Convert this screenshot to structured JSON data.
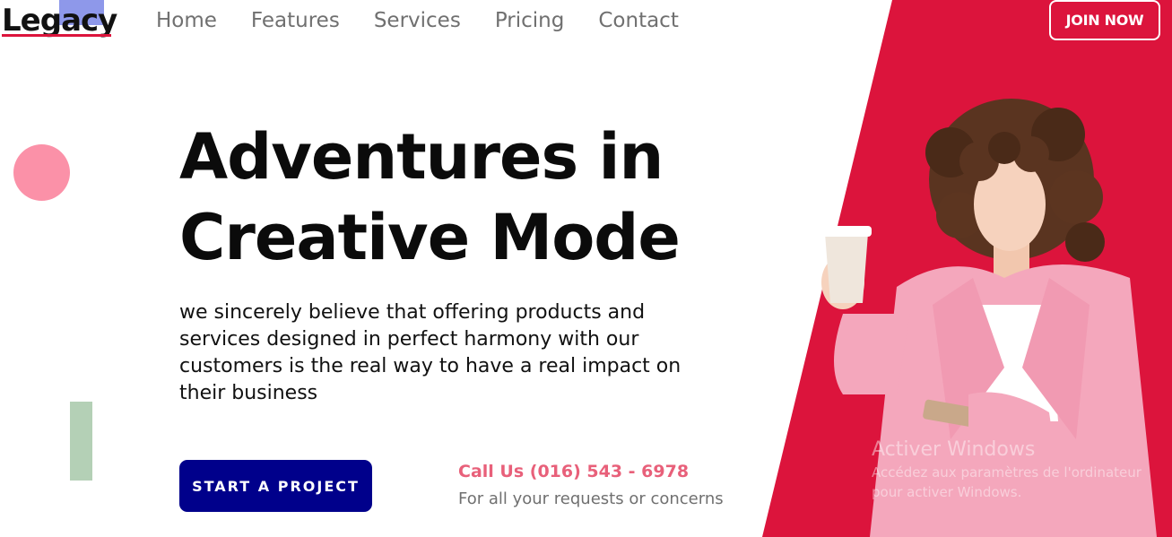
{
  "brand": {
    "logo": "Legacy"
  },
  "nav": {
    "items": [
      "Home",
      "Features",
      "Services",
      "Pricing",
      "Contact"
    ]
  },
  "header": {
    "join_label": "JOIN NOW"
  },
  "hero": {
    "headline_line1": "Adventures in",
    "headline_line2": "Creative Mode",
    "description": "we sincerely believe that offering products and services designed in perfect harmony with our customers is the real way to have a real impact on their business",
    "cta_label": "START A PROJECT",
    "call_text": "Call Us (016) 543 - 6978",
    "call_sub": "For all your requests or concerns"
  },
  "watermark": {
    "title": "Activer Windows",
    "subtitle": "Accédez aux paramètres de l'ordinateur pour activer Windows."
  },
  "colors": {
    "accent": "#dc143c",
    "cta": "#00008b",
    "pink_dot": "#fb91a8",
    "green_bar": "#b4d0b6"
  }
}
